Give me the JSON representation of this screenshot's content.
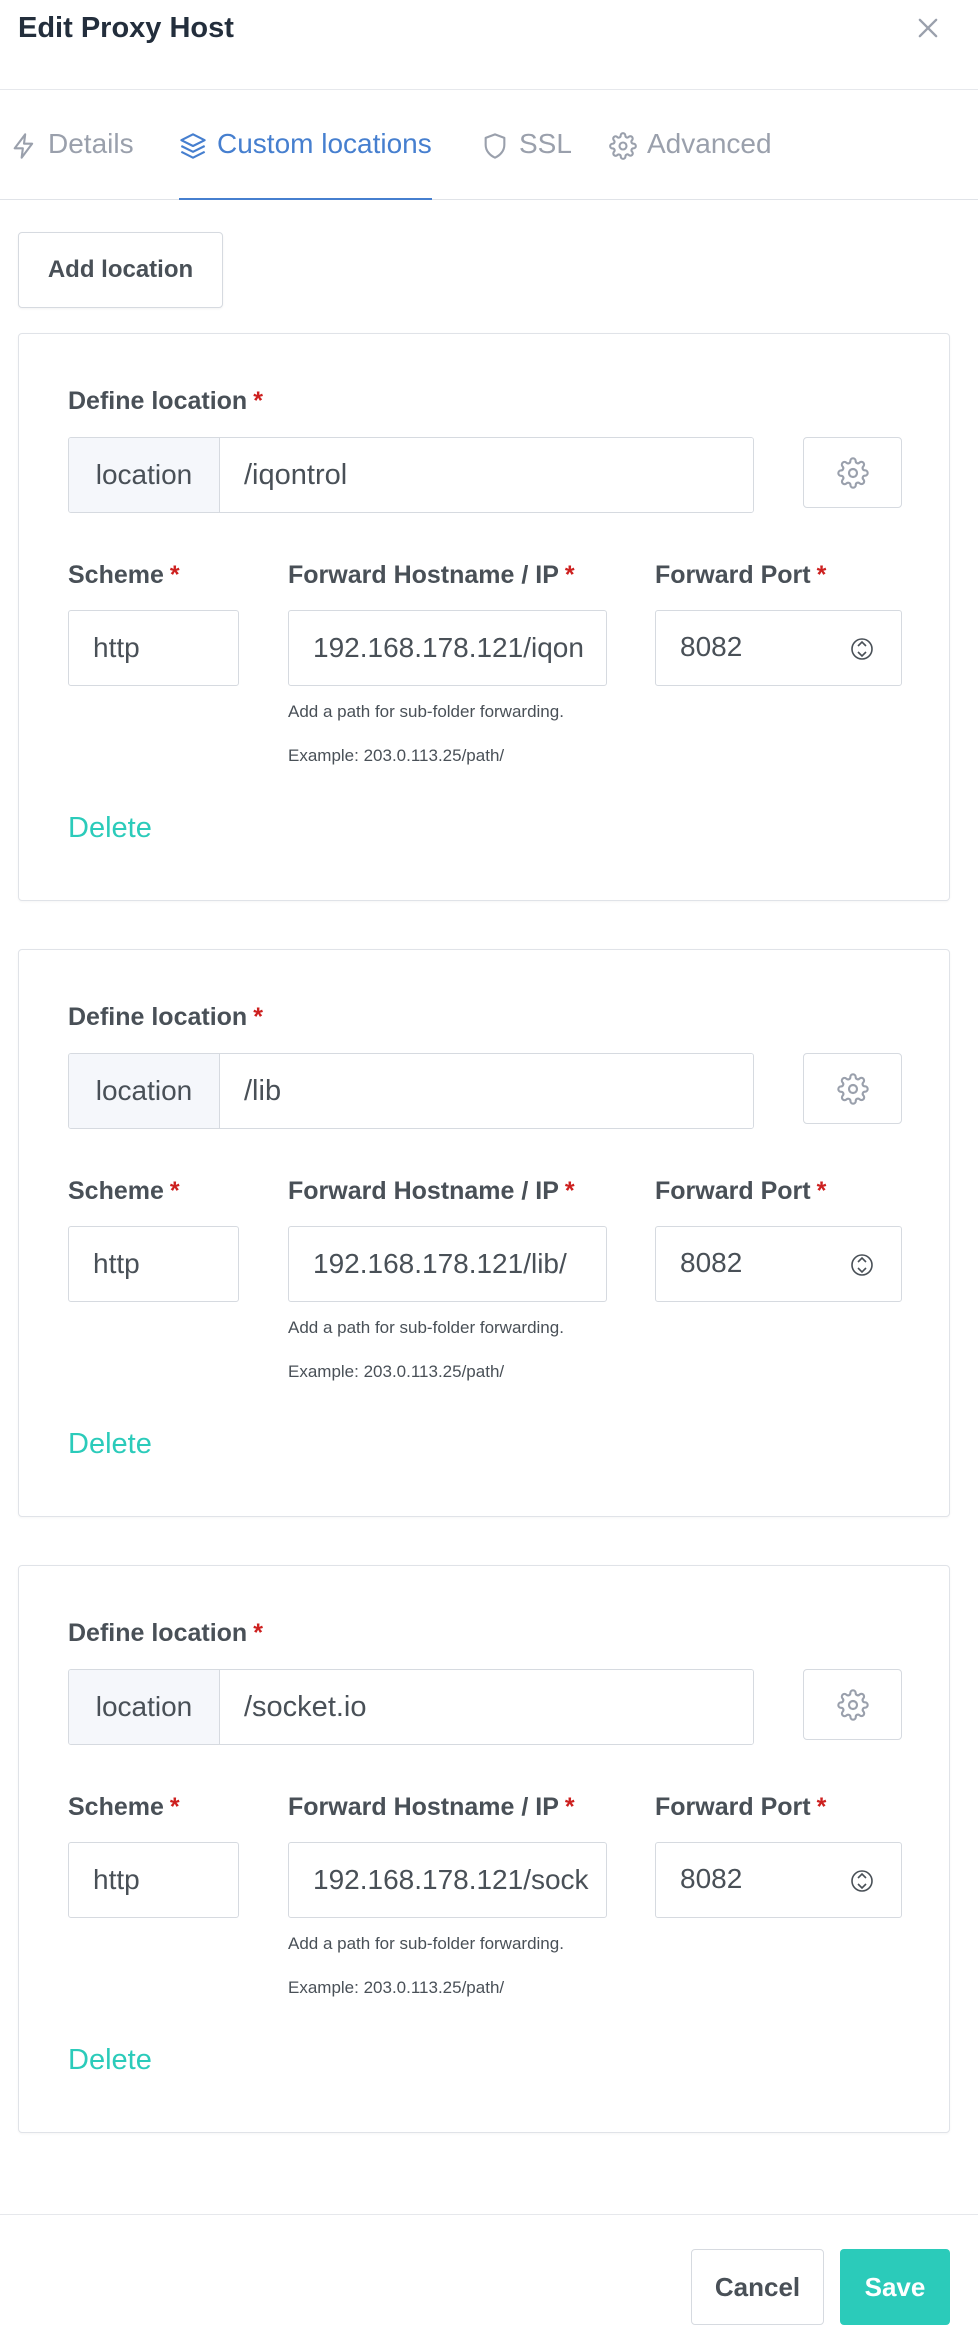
{
  "modal": {
    "title": "Edit Proxy Host",
    "close_icon": "close-icon"
  },
  "tabs": [
    {
      "label": "Details",
      "icon": "bolt-icon",
      "active": false
    },
    {
      "label": "Custom locations",
      "icon": "layers-icon",
      "active": true
    },
    {
      "label": "SSL",
      "icon": "shield-icon",
      "active": false
    },
    {
      "label": "Advanced",
      "icon": "gear-icon",
      "active": false
    }
  ],
  "add_location_label": "Add location",
  "labels": {
    "define_location": "Define location",
    "scheme": "Scheme",
    "forward_host": "Forward Hostname / IP",
    "forward_port": "Forward Port",
    "required": "*",
    "location_prefix": "location",
    "hint_line1": "Add a path for sub-folder forwarding.",
    "hint_line2": "Example: 203.0.113.25/path/",
    "delete": "Delete"
  },
  "locations": [
    {
      "path": "/iqontrol",
      "scheme": "http",
      "host": "192.168.178.121/iqon",
      "port": "8082"
    },
    {
      "path": "/lib",
      "scheme": "http",
      "host": "192.168.178.121/lib/",
      "port": "8082"
    },
    {
      "path": "/socket.io",
      "scheme": "http",
      "host": "192.168.178.121/sock",
      "port": "8082"
    }
  ],
  "footer": {
    "cancel_label": "Cancel",
    "save_label": "Save"
  },
  "colors": {
    "accent_blue": "#467fcf",
    "teal": "#2bcbba",
    "required_red": "#cd201f"
  }
}
